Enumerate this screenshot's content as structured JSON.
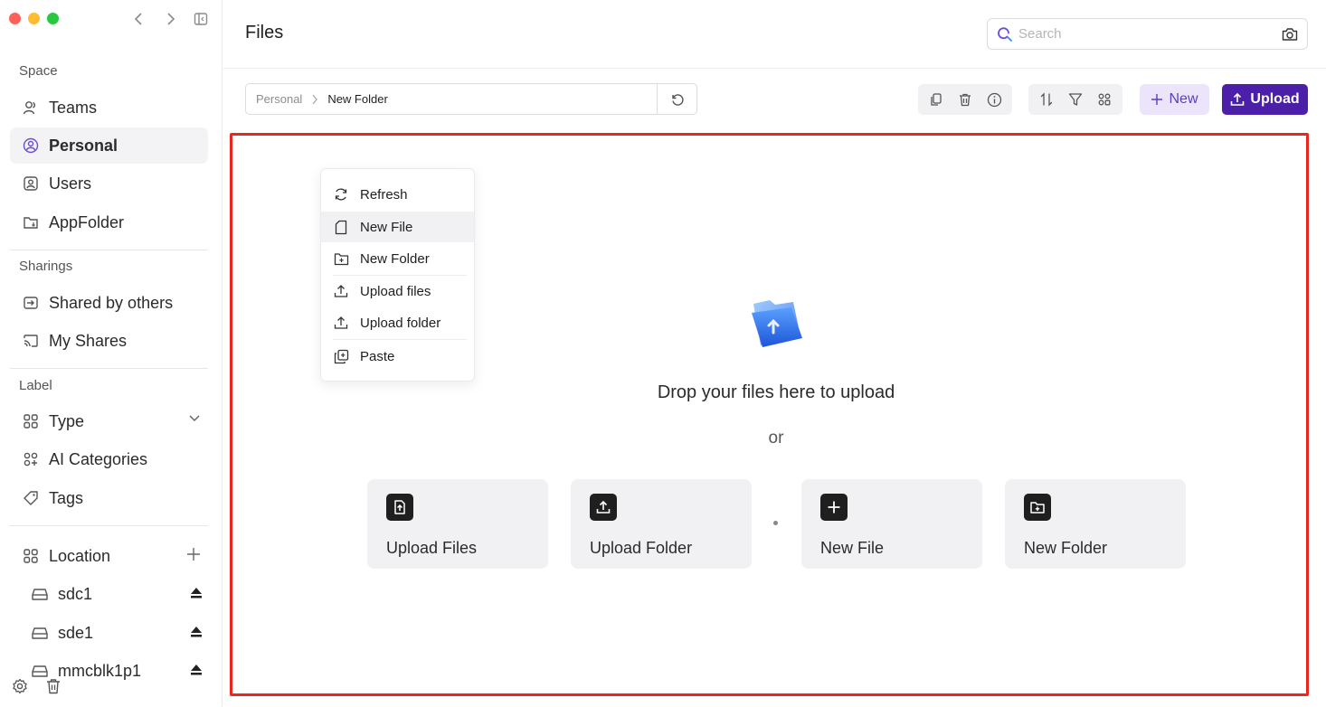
{
  "window": {
    "controls": {
      "close_color": "#fe5f57",
      "minimize_color": "#febc2e",
      "maximize_color": "#28c840"
    }
  },
  "sidebar": {
    "space_label": "Space",
    "space_items": [
      {
        "label": "Teams",
        "icon": "teams-icon"
      },
      {
        "label": "Personal",
        "icon": "personal-icon",
        "active": true
      },
      {
        "label": "Users",
        "icon": "users-icon"
      },
      {
        "label": "AppFolder",
        "icon": "appfolder-icon"
      }
    ],
    "sharings_label": "Sharings",
    "sharing_items": [
      {
        "label": "Shared by others",
        "icon": "shared-by-others-icon"
      },
      {
        "label": "My Shares",
        "icon": "my-shares-icon"
      }
    ],
    "label_label": "Label",
    "label_items": [
      {
        "label": "Type",
        "icon": "type-icon"
      },
      {
        "label": "AI Categories",
        "icon": "ai-categories-icon"
      },
      {
        "label": "Tags",
        "icon": "tags-icon"
      }
    ],
    "location_label": "Location",
    "disks": [
      {
        "label": "sdc1"
      },
      {
        "label": "sde1"
      },
      {
        "label": "mmcblk1p1"
      }
    ]
  },
  "header": {
    "title": "Files",
    "search_placeholder": "Search"
  },
  "toolbar": {
    "breadcrumb_root": "Personal",
    "breadcrumb_current": "New Folder",
    "new_label": "New",
    "upload_label": "Upload",
    "accent": "#4b1fa8"
  },
  "dropzone": {
    "message": "Drop your files here to upload",
    "or": "or",
    "cards": [
      {
        "label": "Upload Files",
        "icon": "upload-file-icon"
      },
      {
        "label": "Upload Folder",
        "icon": "upload-folder-icon"
      },
      {
        "label": "New File",
        "icon": "plus-icon"
      },
      {
        "label": "New Folder",
        "icon": "new-folder-icon"
      }
    ]
  },
  "context_menu": {
    "items": [
      {
        "label": "Refresh",
        "icon": "refresh-icon"
      },
      {
        "label": "New File",
        "icon": "new-file-icon"
      },
      {
        "label": "New Folder",
        "icon": "new-folder-icon"
      },
      {
        "label": "Upload files",
        "icon": "upload-icon"
      },
      {
        "label": "Upload folder",
        "icon": "upload-icon"
      },
      {
        "label": "Paste",
        "icon": "paste-icon"
      }
    ]
  }
}
